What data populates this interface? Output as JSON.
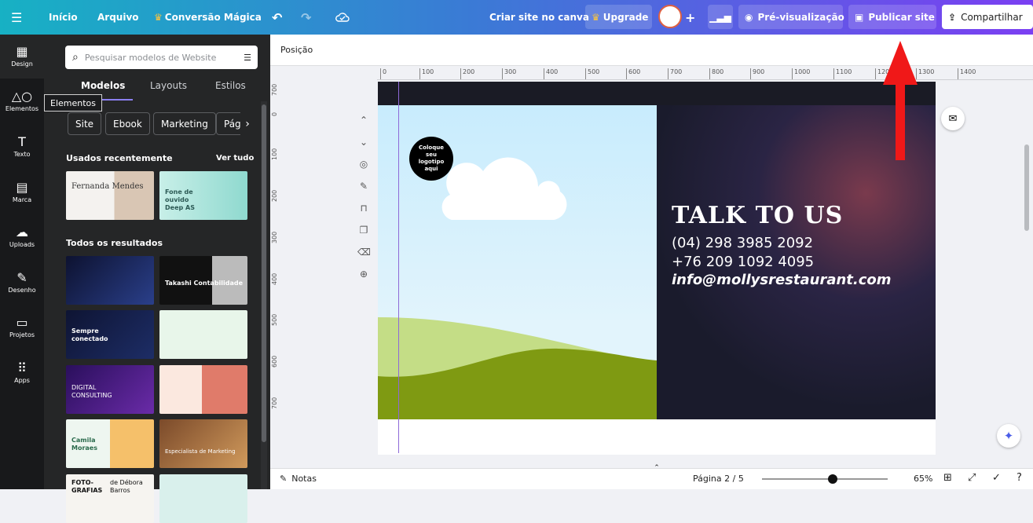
{
  "topbar": {
    "home": "Início",
    "file": "Arquivo",
    "magic": "Conversão Mágica",
    "create_site": "Criar site no canva",
    "upgrade": "Upgrade",
    "preview": "Pré-visualização",
    "publish": "Publicar site",
    "share": "Compartilhar"
  },
  "rail": [
    "Design",
    "Elementos",
    "Texto",
    "Marca",
    "Uploads",
    "Desenho",
    "Projetos",
    "Apps"
  ],
  "tooltip": "Elementos",
  "panel": {
    "search_placeholder": "Pesquisar modelos de Website",
    "tabs": [
      "Modelos",
      "Layouts",
      "Estilos"
    ],
    "chips": [
      "Site",
      "Ebook",
      "Marketing",
      "Pági"
    ],
    "recent_title": "Usados recentemente",
    "see_all": "Ver tudo",
    "all_title": "Todos os resultados",
    "thumbs": {
      "t1": "Fernanda Mendes",
      "t2": "Fone de ouvido Deep AS",
      "t3": "Takashi Contabilidade",
      "t4": "Sempre conectado",
      "t5": "DIGITAL CONSULTING",
      "t6": "Camila Moraes",
      "t7": "Especialista de Marketing",
      "t8": "FOTO-GRAFIAS",
      "t9": "de Débora Barros"
    }
  },
  "context_label": "Posição",
  "ruler_h": [
    "0",
    "100",
    "200",
    "300",
    "400",
    "500",
    "600",
    "700",
    "800",
    "900",
    "1000",
    "1100",
    "1200",
    "1300",
    "1400"
  ],
  "ruler_v": [
    "700",
    "0",
    "100",
    "200",
    "300",
    "400",
    "500",
    "600",
    "700"
  ],
  "canvas": {
    "logo": "Coloque seu logotipo aqui",
    "heading": "TALK TO US",
    "phone1": "(04) 298 3985 2092",
    "phone2": "+76 209 1092 4095",
    "email": "info@mollysrestaurant.com"
  },
  "bottombar": {
    "notes": "Notas",
    "page": "Página 2 / 5",
    "zoom": "65%",
    "zoom_level": 0.56
  }
}
